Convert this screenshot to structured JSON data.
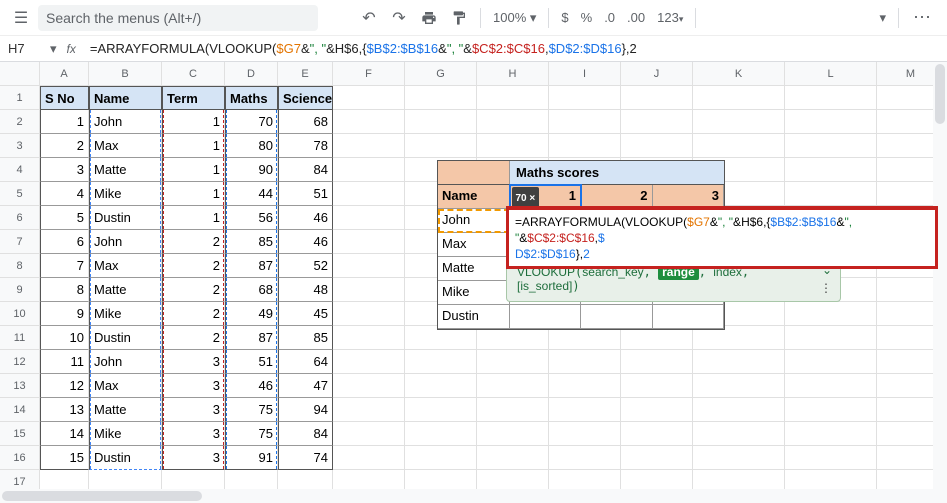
{
  "toolbar": {
    "search_placeholder": "Search the menus (Alt+/)",
    "zoom": "100%",
    "currency": "$",
    "percent": "%",
    "dec_dec": ".0",
    "dec_inc": ".00",
    "fmt": "123"
  },
  "namebox": {
    "cell": "H7"
  },
  "formula": {
    "raw_parts": [
      {
        "t": "=ARRAYFORMULA(",
        "c": ""
      },
      {
        "t": "VLOOKUP(",
        "c": ""
      },
      {
        "t": "$G7",
        "c": "sp-orange"
      },
      {
        "t": "&",
        "c": ""
      },
      {
        "t": "\", \"",
        "c": "sp-txt"
      },
      {
        "t": "&",
        "c": ""
      },
      {
        "t": "H$6",
        "c": ""
      },
      {
        "t": ",{",
        "c": ""
      },
      {
        "t": "$B$2:$B$16",
        "c": "sp-blue"
      },
      {
        "t": "&",
        "c": ""
      },
      {
        "t": "\", \"",
        "c": "sp-txt"
      },
      {
        "t": "&",
        "c": ""
      },
      {
        "t": "$C$2:$C$16",
        "c": "sp-red"
      },
      {
        "t": ",",
        "c": ""
      },
      {
        "t": "$D$2:$D$16",
        "c": "sp-blue"
      },
      {
        "t": "},",
        "c": ""
      },
      {
        "t": "2",
        "c": ""
      }
    ]
  },
  "columns": [
    "A",
    "B",
    "C",
    "D",
    "E",
    "F",
    "G",
    "H",
    "I",
    "J",
    "K",
    "L",
    "M"
  ],
  "headers": {
    "A": "S No",
    "B": "Name",
    "C": "Term",
    "D": "Maths",
    "E": "Science"
  },
  "rows": [
    {
      "A": "1",
      "B": "John",
      "C": "1",
      "D": "70",
      "E": "68"
    },
    {
      "A": "2",
      "B": "Max",
      "C": "1",
      "D": "80",
      "E": "78"
    },
    {
      "A": "3",
      "B": "Matte",
      "C": "1",
      "D": "90",
      "E": "84"
    },
    {
      "A": "4",
      "B": "Mike",
      "C": "1",
      "D": "44",
      "E": "51"
    },
    {
      "A": "5",
      "B": "Dustin",
      "C": "1",
      "D": "56",
      "E": "46"
    },
    {
      "A": "6",
      "B": "John",
      "C": "2",
      "D": "85",
      "E": "46"
    },
    {
      "A": "7",
      "B": "Max",
      "C": "2",
      "D": "87",
      "E": "52"
    },
    {
      "A": "8",
      "B": "Matte",
      "C": "2",
      "D": "68",
      "E": "48"
    },
    {
      "A": "9",
      "B": "Mike",
      "C": "2",
      "D": "49",
      "E": "45"
    },
    {
      "A": "10",
      "B": "Dustin",
      "C": "2",
      "D": "87",
      "E": "85"
    },
    {
      "A": "11",
      "B": "John",
      "C": "3",
      "D": "51",
      "E": "64"
    },
    {
      "A": "12",
      "B": "Max",
      "C": "3",
      "D": "46",
      "E": "47"
    },
    {
      "A": "13",
      "B": "Matte",
      "C": "3",
      "D": "75",
      "E": "94"
    },
    {
      "A": "14",
      "B": "Mike",
      "C": "3",
      "D": "75",
      "E": "84"
    },
    {
      "A": "15",
      "B": "Dustin",
      "C": "3",
      "D": "91",
      "E": "74"
    }
  ],
  "lookup": {
    "title": "Maths scores",
    "col_name": "Name",
    "terms": [
      "1",
      "2",
      "3"
    ],
    "names": [
      "John",
      "Max",
      "Matte",
      "Mike",
      "Dustin"
    ],
    "preview": "70 ×"
  },
  "popup_formula": {
    "line1": [
      {
        "t": "=",
        "c": ""
      },
      {
        "t": "ARRAYFORMULA(",
        "c": ""
      },
      {
        "t": "VLOOKUP(",
        "c": ""
      },
      {
        "t": "$G7",
        "c": "sp-orange"
      },
      {
        "t": "&",
        "c": ""
      },
      {
        "t": "\", \"",
        "c": "sp-txt"
      },
      {
        "t": "&",
        "c": ""
      },
      {
        "t": "H$6",
        "c": ""
      },
      {
        "t": ",{",
        "c": ""
      },
      {
        "t": "$B$2:$B$16",
        "c": "sp-blue"
      },
      {
        "t": "&",
        "c": ""
      },
      {
        "t": "\", \"",
        "c": "sp-txt"
      },
      {
        "t": "&",
        "c": ""
      },
      {
        "t": "$C$2:$C$16",
        "c": "sp-red"
      },
      {
        "t": ",",
        "c": ""
      },
      {
        "t": "$",
        "c": "sp-blue"
      }
    ],
    "line2": [
      {
        "t": "D$2:$D$16",
        "c": "sp-blue"
      },
      {
        "t": "},",
        "c": ""
      },
      {
        "t": "2",
        "c": "sp-blue"
      }
    ]
  },
  "hint": {
    "fn": "VLOOKUP",
    "a1": "search_key",
    "a2": "range",
    "a3": "index",
    "a4": "[is_sorted]"
  }
}
